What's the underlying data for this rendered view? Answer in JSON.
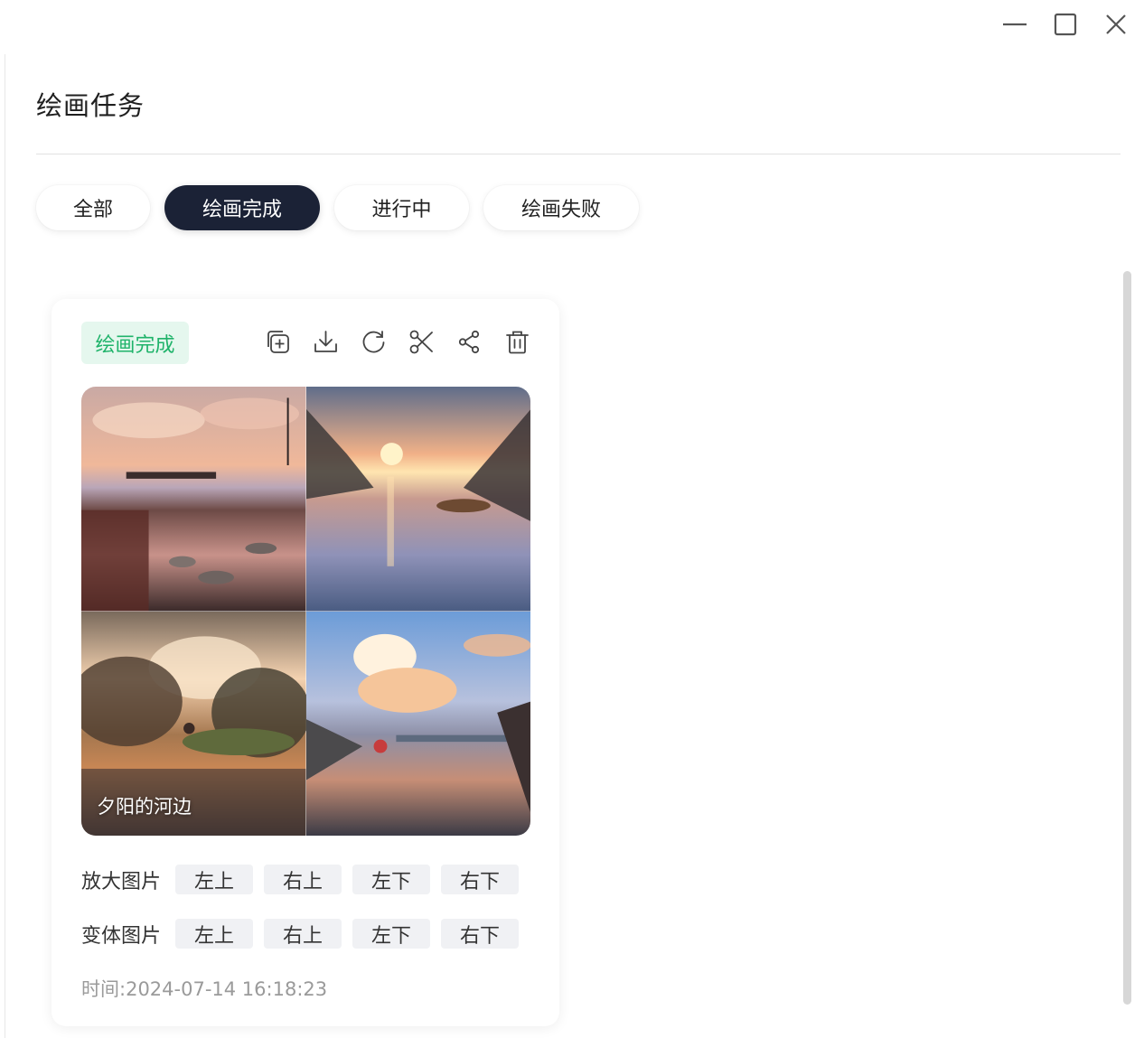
{
  "window_controls": {
    "minimize_icon": "minimize-icon",
    "maximize_icon": "maximize-icon",
    "close_icon": "close-icon"
  },
  "page": {
    "title": "绘画任务"
  },
  "tabs": [
    {
      "label": "全部",
      "active": false
    },
    {
      "label": "绘画完成",
      "active": true
    },
    {
      "label": "进行中",
      "active": false
    },
    {
      "label": "绘画失败",
      "active": false
    }
  ],
  "card": {
    "status": "绘画完成",
    "status_color": "#1fb36a",
    "actions": [
      "copy-add-icon",
      "download-icon",
      "refresh-icon",
      "scissors-icon",
      "share-icon",
      "trash-icon"
    ],
    "image_caption": "夕阳的河边",
    "upscale": {
      "label": "放大图片",
      "options": [
        "左上",
        "右上",
        "左下",
        "右下"
      ]
    },
    "variation": {
      "label": "变体图片",
      "options": [
        "左上",
        "右上",
        "左下",
        "右下"
      ]
    },
    "time_label": "时间:",
    "time_value": "2024-07-14 16:18:23"
  },
  "colors": {
    "accent_dark": "#1b2236",
    "success_green": "#1fb36a",
    "success_bg": "#e5f7ee"
  }
}
